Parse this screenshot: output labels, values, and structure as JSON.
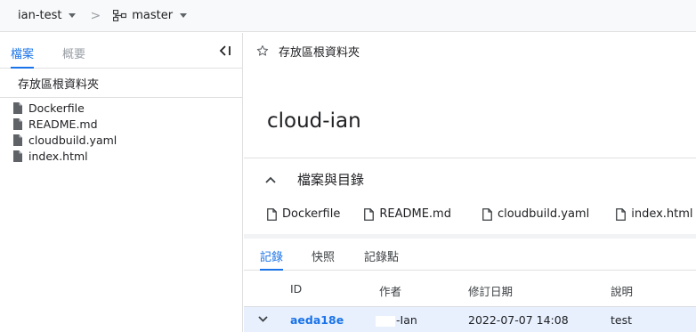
{
  "topbar": {
    "repo": "ian-test",
    "branch": "master",
    "separator": ">"
  },
  "left": {
    "tabs": [
      "檔案",
      "概要"
    ],
    "collapse_label": "<I",
    "root_label": "存放區根資料夾",
    "files": [
      "Dockerfile",
      "README.md",
      "cloudbuild.yaml",
      "index.html"
    ]
  },
  "right": {
    "header_title": "存放區根資料夾",
    "repo_name": "cloud-ian",
    "section_title": "檔案與目錄",
    "files": [
      "Dockerfile",
      "README.md",
      "cloudbuild.yaml",
      "index.html"
    ],
    "bottom_tabs": [
      "記錄",
      "快照",
      "記錄點"
    ],
    "table": {
      "headers": [
        "ID",
        "作者",
        "修訂日期",
        "說明"
      ],
      "rows": [
        {
          "id": "aeda18e",
          "author": "-Ian",
          "date": "2022-07-07 14:08",
          "description": "test"
        }
      ]
    }
  }
}
